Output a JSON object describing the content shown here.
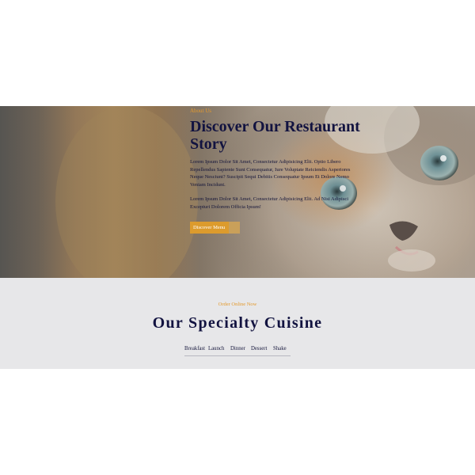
{
  "about": {
    "kicker": "About Us",
    "title": "Discover Our Restaurant Story",
    "paragraphs": [
      "Lorem Ipsum Dolor Sit Amet, Consectetur Adipisicing Elit. Optio Libero Repellendus Sapiente Sunt Consequatur, Iure Voluptate Reiciendis Asperiores Neque Nesciunt? Suscipit Sequi Debitis Consequatur Ipsum Et Dolore Nemo Veniam Incidunt.",
      "Lorem Ipsum Dolor Sit Amet, Consectetur Adipisicing Elit. Ad Nisi Adipisci Excepturi Dolorem Officia Ipsum!"
    ],
    "button_label": "Discover Menu"
  },
  "specialty": {
    "kicker": "Order Online Now",
    "title": "Our Specialty Cuisine",
    "tabs": [
      "Breakfast",
      "Launch",
      "Dinner",
      "Dessert",
      "Shake"
    ]
  },
  "colors": {
    "accent": "#dc9b2d",
    "heading": "#121340",
    "section_bg": "#e7e7e9"
  }
}
